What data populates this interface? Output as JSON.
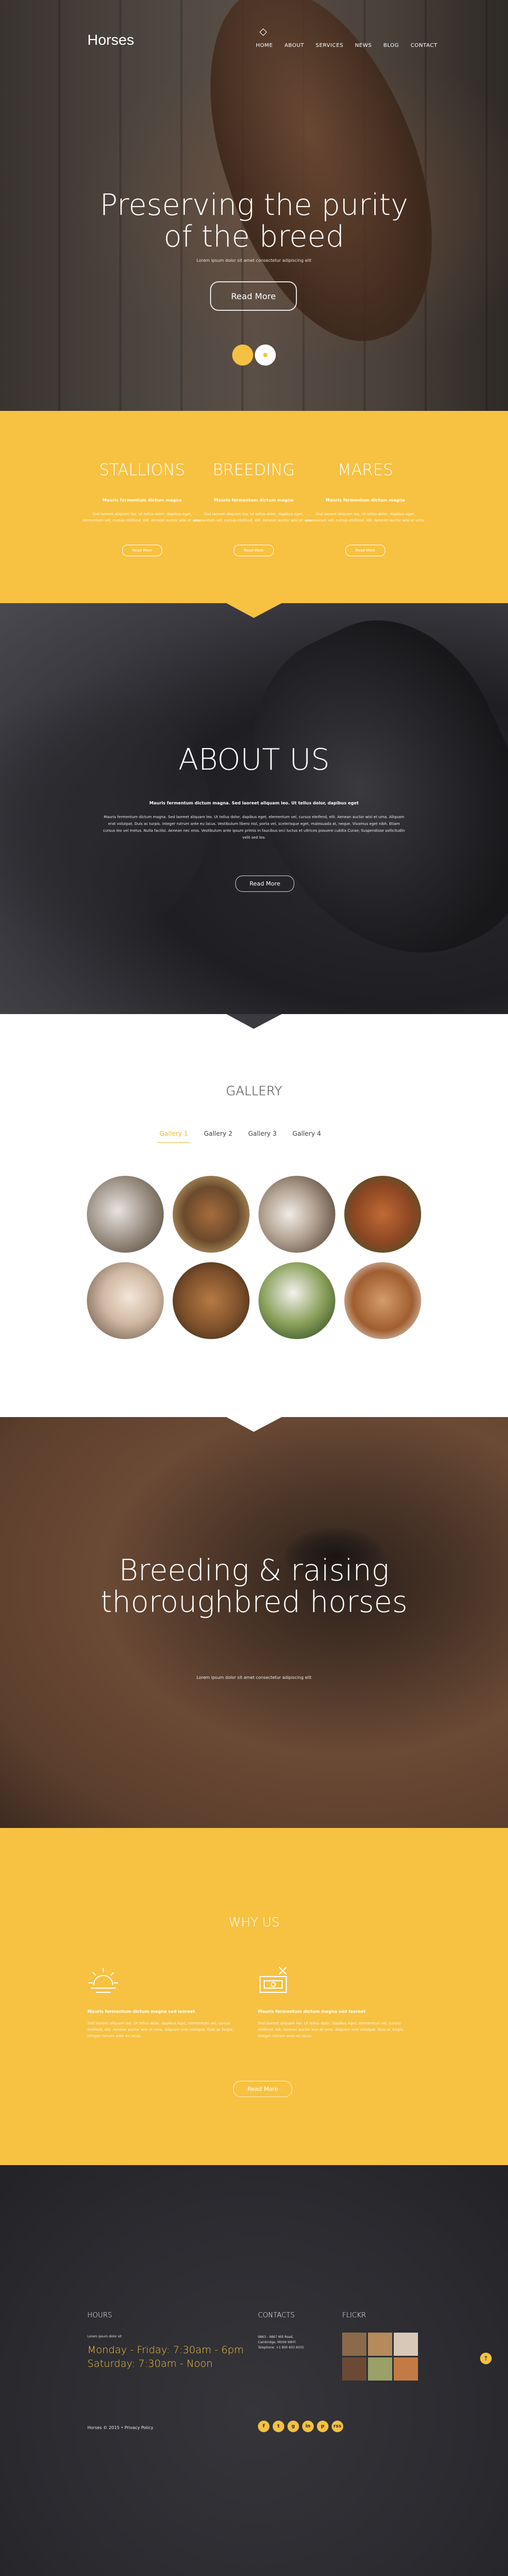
{
  "hero": {
    "logo": "Horses",
    "nav": [
      "HOME",
      "ABOUT",
      "SERVICES",
      "NEWS",
      "BLOG",
      "CONTACT"
    ],
    "title_line1": "Preserving the purity",
    "title_line2": "of the breed",
    "subtitle": "Lorem ipsum dolor sit amet consectetur adipiscing elit",
    "button": "Read More"
  },
  "categories": [
    {
      "title": "STALLIONS",
      "sub": "Mauris fermentum dictum magna",
      "text": "Sed laoreet aliquam leo. Ut tellus dolor, dapibus eget, elementum vel, cursus eleifend, elit. Aenean auctor wisi et urna.",
      "button": "Read More"
    },
    {
      "title": "BREEDING",
      "sub": "Mauris fermentum dictum magna",
      "text": "Sed laoreet aliquam leo. Ut tellus dolor, dapibus eget, elementum vel, cursus eleifend, elit. Aenean auctor wisi et urna.",
      "button": "Read More"
    },
    {
      "title": "MARES",
      "sub": "Mauris fermentum dictum magna",
      "text": "Sed laoreet aliquam leo. Ut tellus dolor, dapibus eget, elementum vel, cursus eleifend, elit. Aenean auctor wisi et urna.",
      "button": "Read More"
    }
  ],
  "about": {
    "title": "ABOUT US",
    "subtitle": "Mauris fermentum dictum magna. Sed laoreet aliquam leo. Ut tellus dolor, dapibus eget",
    "text": "Mauris fermentum dictum magna. Sed laoreet aliquam leo. Ut tellus dolor, dapibus eget, elementum vel, cursus eleifend, elit. Aenean auctor wisi et urna. Aliquam erat volutpat. Duis ac turpis. Integer rutrum ante eu lacus. Vestibulum libero nisl, porta vel, scelerisque eget, malesuada at, neque. Vivamus eget nibh. Etiam cursus leo vel metus. Nulla facilisi. Aenean nec eros. Vestibulum ante ipsum primis in faucibus orci luctus et ultrices posuere cubilia Curae; Suspendisse sollicitudin velit sed leo.",
    "button": "Read More"
  },
  "gallery": {
    "title": "GALLERY",
    "tabs": [
      "Gallery 1",
      "Gallery 2",
      "Gallery 3",
      "Gallery 4"
    ],
    "photos": [
      "rider-jumping",
      "horses-grazing",
      "girl-with-white-horse",
      "chestnut-horse",
      "woman-hugging-horse",
      "horse-herd",
      "rider-on-white-horse",
      "horse-portrait"
    ]
  },
  "breeding": {
    "title_line1": "Breeding & raising",
    "title_line2": "thoroughbred horses",
    "subtitle": "Lorem ipsum dolor sit amet consectetur adipiscing elit"
  },
  "why": {
    "title": "WHY US",
    "cols": [
      {
        "icon": "sun-icon",
        "heading": "Mauris fermentum dictum magna sed laoreet",
        "text": "Sed laoreet aliquam leo. Ut tellus dolor, dapibus eget, elementum vel, cursus eleifend, elit. Aenean auctor wisi et urna. Aliquam erat volutpat. Duis ac turpis. Integer rutrum ante eu lacus."
      },
      {
        "icon": "money-icon",
        "heading": "Mauris fermentum dictum magna sed laoreet",
        "text": "Sed laoreet aliquam leo. Ut tellus dolor, dapibus eget, elementum vel, cursus eleifend, elit. Aenean auctor wisi et urna. Aliquam erat volutpat. Duis ac turpis. Integer rutrum ante eu lacus."
      }
    ],
    "button": "Read More"
  },
  "footer": {
    "hours_title": "HOURS",
    "hours_sub": "Lorem ipsum dolor sit",
    "hours_line1": "Monday - Friday: 7:30am - 6pm",
    "hours_line2": "Saturday: 7:30am - Noon",
    "contacts_title": "CONTACTS",
    "contacts_lines": [
      "9863 - 9867 Mill Road,",
      "Cambridge, MG09 99HT.",
      "Telephone: +1 800 603 6035"
    ],
    "flickr_title": "FLICKR",
    "copyright": "Horses © 2015 • Privacy Policy",
    "social": [
      "f",
      "t",
      "g",
      "in",
      "p",
      "rss"
    ]
  },
  "colors": {
    "accent": "#f7c142",
    "dark": "#2b2b30"
  }
}
